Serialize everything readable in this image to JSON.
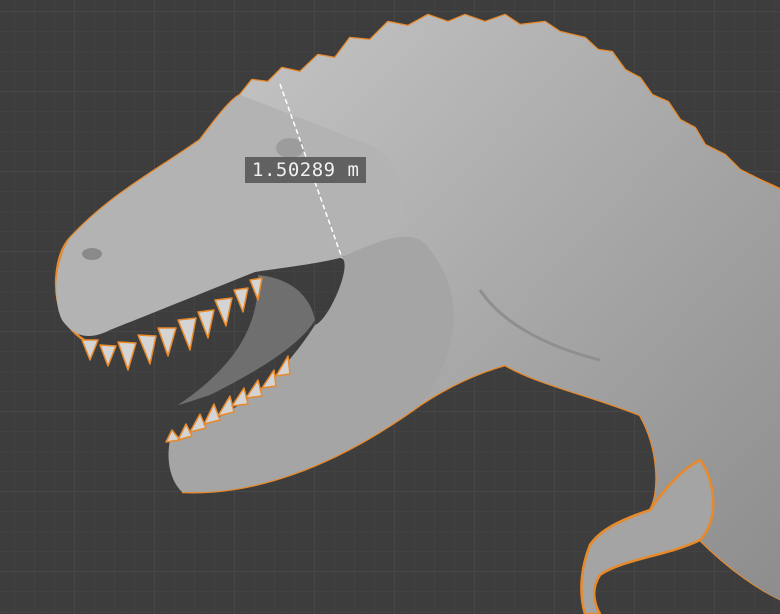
{
  "viewport": {
    "measurement": {
      "value": "1.50289 m"
    },
    "colors": {
      "background": "#3d3d3d",
      "grid": "#474747",
      "mesh": "#a9a9a9",
      "selection_outline": "#e8892a",
      "measure_line": "#ffffff"
    }
  },
  "object": {
    "icon": "trex-sculpt-mesh",
    "selected": true
  }
}
